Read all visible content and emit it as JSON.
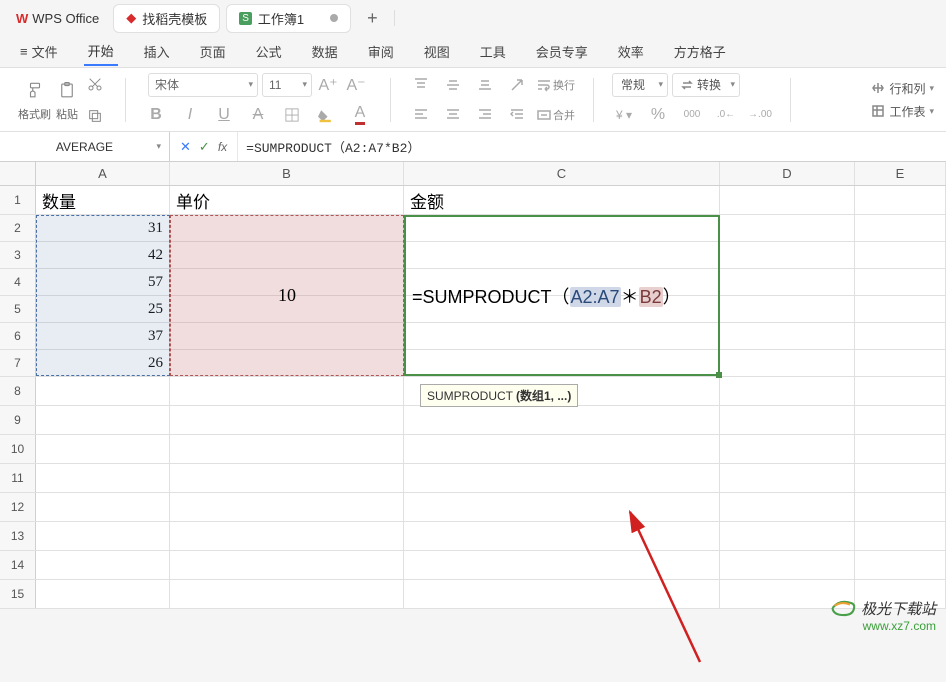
{
  "app": {
    "name": "WPS Office"
  },
  "tabs": {
    "template": {
      "label": "找稻壳模板"
    },
    "workbook": {
      "label": "工作簿1",
      "badge": "S"
    }
  },
  "menu": {
    "file": "文件",
    "items": [
      "开始",
      "插入",
      "页面",
      "公式",
      "数据",
      "审阅",
      "视图",
      "工具",
      "会员专享",
      "效率",
      "方方格子"
    ],
    "active_index": 0
  },
  "ribbon": {
    "format_brush": "格式刷",
    "paste": "粘贴",
    "font_name": "宋体",
    "font_size": "11",
    "number_format": "常规",
    "convert": "转换",
    "rows_cols": "行和列",
    "worksheet": "工作表",
    "wrap": "换行",
    "merge": "合并"
  },
  "formula_bar": {
    "name_box": "AVERAGE",
    "formula": "=SUMPRODUCT（A2:A7*B2）"
  },
  "sheet": {
    "cols": [
      "A",
      "B",
      "C",
      "D",
      "E"
    ],
    "headers": {
      "A": "数量",
      "B": "单价",
      "C": "金额"
    },
    "values_A": [
      "31",
      "42",
      "57",
      "25",
      "37",
      "26"
    ],
    "value_B": "10",
    "formula_parts": {
      "pre": "=SUMPRODUCT（",
      "ref1": "A2:A7",
      "mid": "＊",
      "ref2": "B2",
      "post": "）"
    },
    "tooltip": {
      "fn": "SUMPRODUCT",
      "args": "(数组1, ...)"
    }
  },
  "watermark": {
    "name": "极光下载站",
    "url": "www.xz7.com"
  }
}
